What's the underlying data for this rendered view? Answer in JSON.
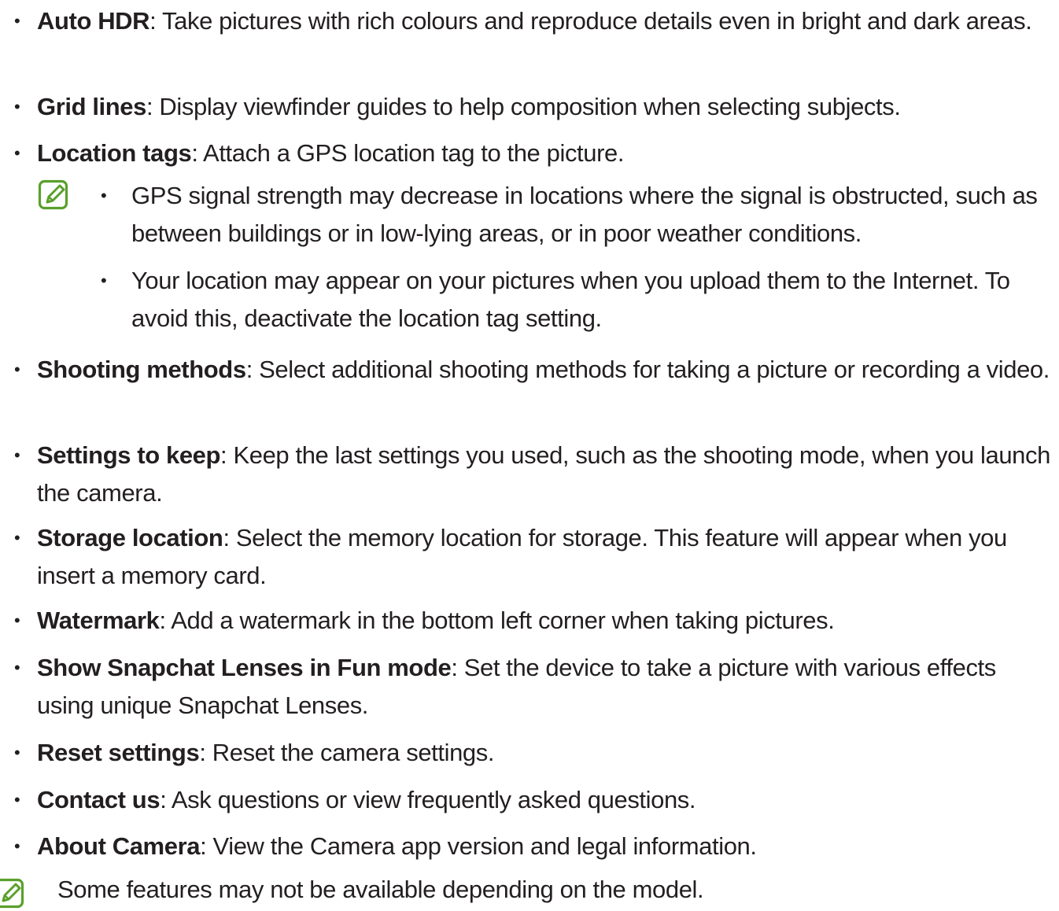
{
  "items": [
    {
      "term": "Auto HDR",
      "desc": ": Take pictures with rich colours and reproduce details even in bright and dark areas."
    },
    {
      "term": "Grid lines",
      "desc": ": Display viewfinder guides to help composition when selecting subjects."
    },
    {
      "term": "Location tags",
      "desc": ": Attach a GPS location tag to the picture."
    },
    {
      "term": "Shooting methods",
      "desc": ": Select additional shooting methods for taking a picture or recording a video."
    },
    {
      "term": "Settings to keep",
      "desc": ": Keep the last settings you used, such as the shooting mode, when you launch the camera."
    },
    {
      "term": "Storage location",
      "desc": ": Select the memory location for storage. This feature will appear when you insert a memory card."
    },
    {
      "term": "Watermark",
      "desc": ": Add a watermark in the bottom left corner when taking pictures."
    },
    {
      "term": "Show Snapchat Lenses in Fun mode",
      "desc": ": Set the device to take a picture with various effects using unique Snapchat Lenses."
    },
    {
      "term": "Reset settings",
      "desc": ": Reset the camera settings."
    },
    {
      "term": "Contact us",
      "desc": ": Ask questions or view frequently asked questions."
    },
    {
      "term": "About Camera",
      "desc": ": View the Camera app version and legal information."
    }
  ],
  "location_notes": [
    "GPS signal strength may decrease in locations where the signal is obstructed, such as between buildings or in low-lying areas, or in poor weather conditions.",
    "Your location may appear on your pictures when you upload them to the Internet. To avoid this, deactivate the location tag setting."
  ],
  "footer_note": "Some features may not be available depending on the model.",
  "bullet_char": "•",
  "colors": {
    "text": "#231f20",
    "note_icon": "#5aa02c"
  },
  "icons": {
    "note": "note-pencil-icon"
  }
}
